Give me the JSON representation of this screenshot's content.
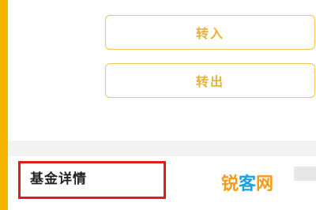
{
  "actions": {
    "transfer_in_label": "转入",
    "transfer_out_label": "转出"
  },
  "detail": {
    "label": "基金详情"
  },
  "watermark": {
    "part1": "锐",
    "part2": "客",
    "part3": "网"
  },
  "colors": {
    "frame_yellow": "#f4b400",
    "button_border": "#f0c55a",
    "button_text": "#e8b23a",
    "highlight_red": "#e01c1c",
    "watermark_orange": "#f59a16",
    "watermark_blue": "#1da1e6"
  }
}
